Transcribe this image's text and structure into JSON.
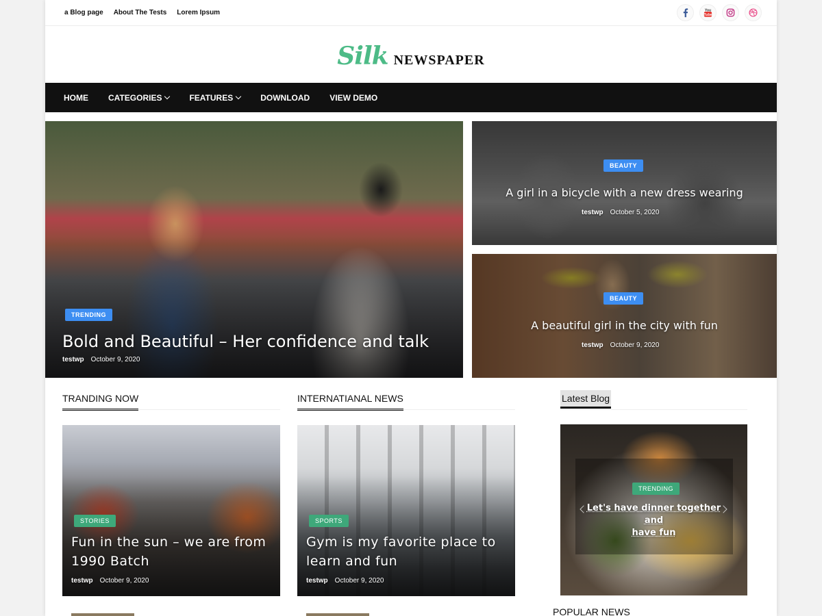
{
  "topbar": {
    "links": [
      "a Blog page",
      "About The Tests",
      "Lorem Ipsum"
    ],
    "social_icons": [
      "facebook-icon",
      "youtube-icon",
      "instagram-icon",
      "dribbble-icon"
    ]
  },
  "logo": {
    "brand": "Silk",
    "name": "NEWSPAPER",
    "color": "#4dbb87"
  },
  "nav": {
    "items": [
      {
        "label": "HOME",
        "dropdown": false
      },
      {
        "label": "CATEGORIES",
        "dropdown": true
      },
      {
        "label": "FEATURES",
        "dropdown": true
      },
      {
        "label": "DOWNLOAD",
        "dropdown": false
      },
      {
        "label": "VIEW DEMO",
        "dropdown": false
      }
    ]
  },
  "hero": {
    "main": {
      "badge": "TRENDING",
      "title": "Bold and Beautiful – Her confidence and talk",
      "author": "testwp",
      "date": "October 9, 2020"
    },
    "side": [
      {
        "badge": "BEAUTY",
        "title": "A girl in a bicycle with a new dress wearing",
        "author": "testwp",
        "date": "October 5, 2020"
      },
      {
        "badge": "BEAUTY",
        "title": "A beautiful girl in the city with fun",
        "author": "testwp",
        "date": "October 9, 2020"
      }
    ]
  },
  "sections": {
    "trending_title": "TRANDING NOW",
    "international_title": "INTERNATIANAL NEWS",
    "latest_title": "Latest Blog",
    "popular_title": "POPULAR NEWS"
  },
  "cards": [
    {
      "badge": "STORIES",
      "title_line1": "Fun in the sun – we are from",
      "title_line2": "1990 Batch",
      "author": "testwp",
      "date": "October 9, 2020"
    },
    {
      "badge": "SPORTS",
      "title_line1": "Gym is my favorite place to",
      "title_line2": "learn and fun",
      "author": "testwp",
      "date": "October 9, 2020"
    }
  ],
  "latest_post": {
    "badge": "TRENDING",
    "title_line1": "Let's have dinner together and",
    "title_line2": "have fun"
  },
  "colors": {
    "accent_green": "#3ea87a",
    "accent_blue": "#3d8ef2",
    "nav_bg": "#111111"
  }
}
